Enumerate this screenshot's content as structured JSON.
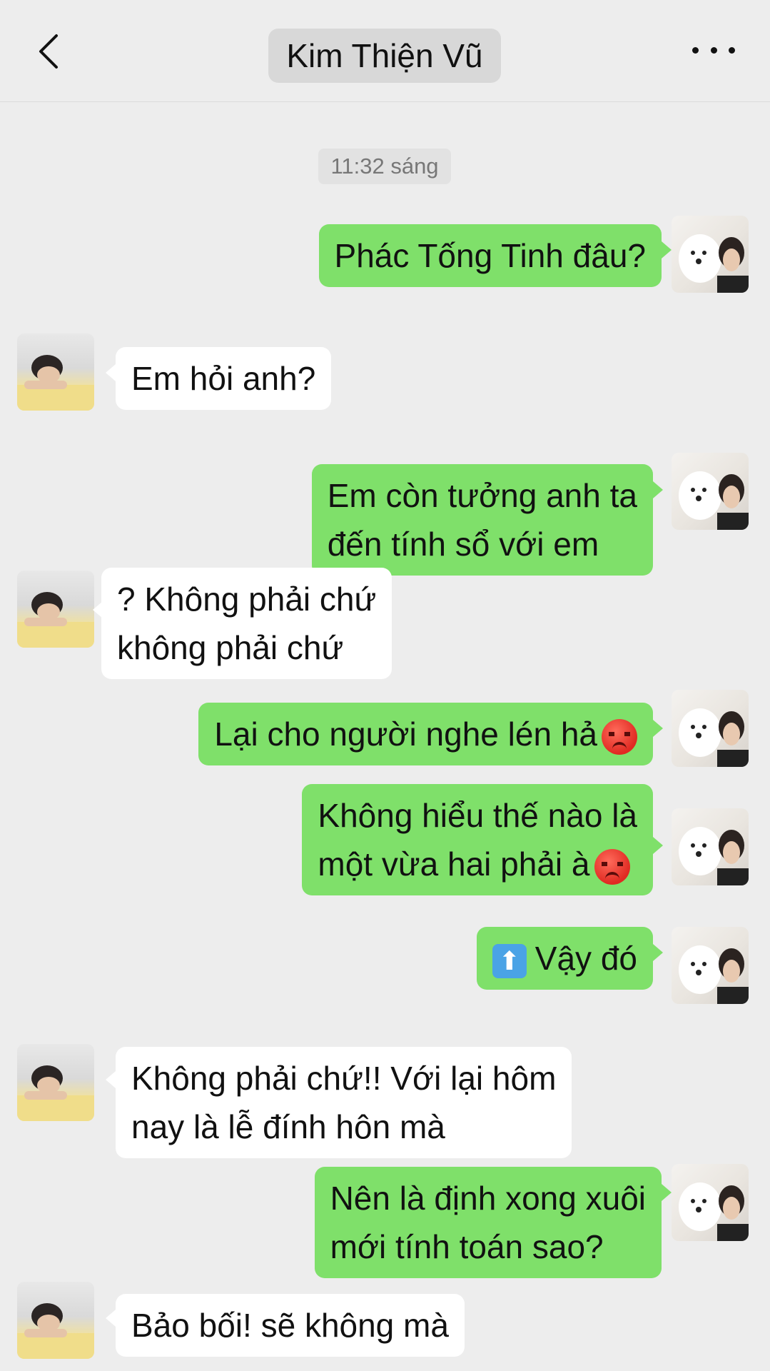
{
  "header": {
    "back_icon": "chevron-left-icon",
    "title": "Kim Thiện Vũ",
    "more_icon": "more-dots-icon"
  },
  "timestamp": "11:32 sáng",
  "messages": [
    {
      "side": "me",
      "lines": [
        "Phác Tống Tinh đâu?"
      ]
    },
    {
      "side": "other",
      "lines": [
        "Em hỏi anh?"
      ]
    },
    {
      "side": "me",
      "lines": [
        "Em còn tưởng anh ta",
        "đến tính sổ với em"
      ]
    },
    {
      "side": "other",
      "lines": [
        "? Không phải chứ",
        "không phải chứ"
      ]
    },
    {
      "side": "me",
      "lines": [
        "Lại cho người nghe lén hả"
      ],
      "emoji": "angry-face-icon"
    },
    {
      "side": "me",
      "lines": [
        "Không hiểu thế nào là",
        "một vừa hai phải à"
      ],
      "emoji": "angry-face-icon"
    },
    {
      "side": "me",
      "lines": [
        "Vậy đó"
      ],
      "prefix_icon": "up-arrow-icon"
    },
    {
      "side": "other",
      "lines": [
        "Không phải chứ!! Với lại hôm",
        "nay là lễ đính hôn mà"
      ]
    },
    {
      "side": "me",
      "lines": [
        "Nên là định xong xuôi",
        "mới tính toán sao?"
      ]
    },
    {
      "side": "other",
      "lines": [
        "Bảo bối! sẽ không mà"
      ]
    }
  ]
}
